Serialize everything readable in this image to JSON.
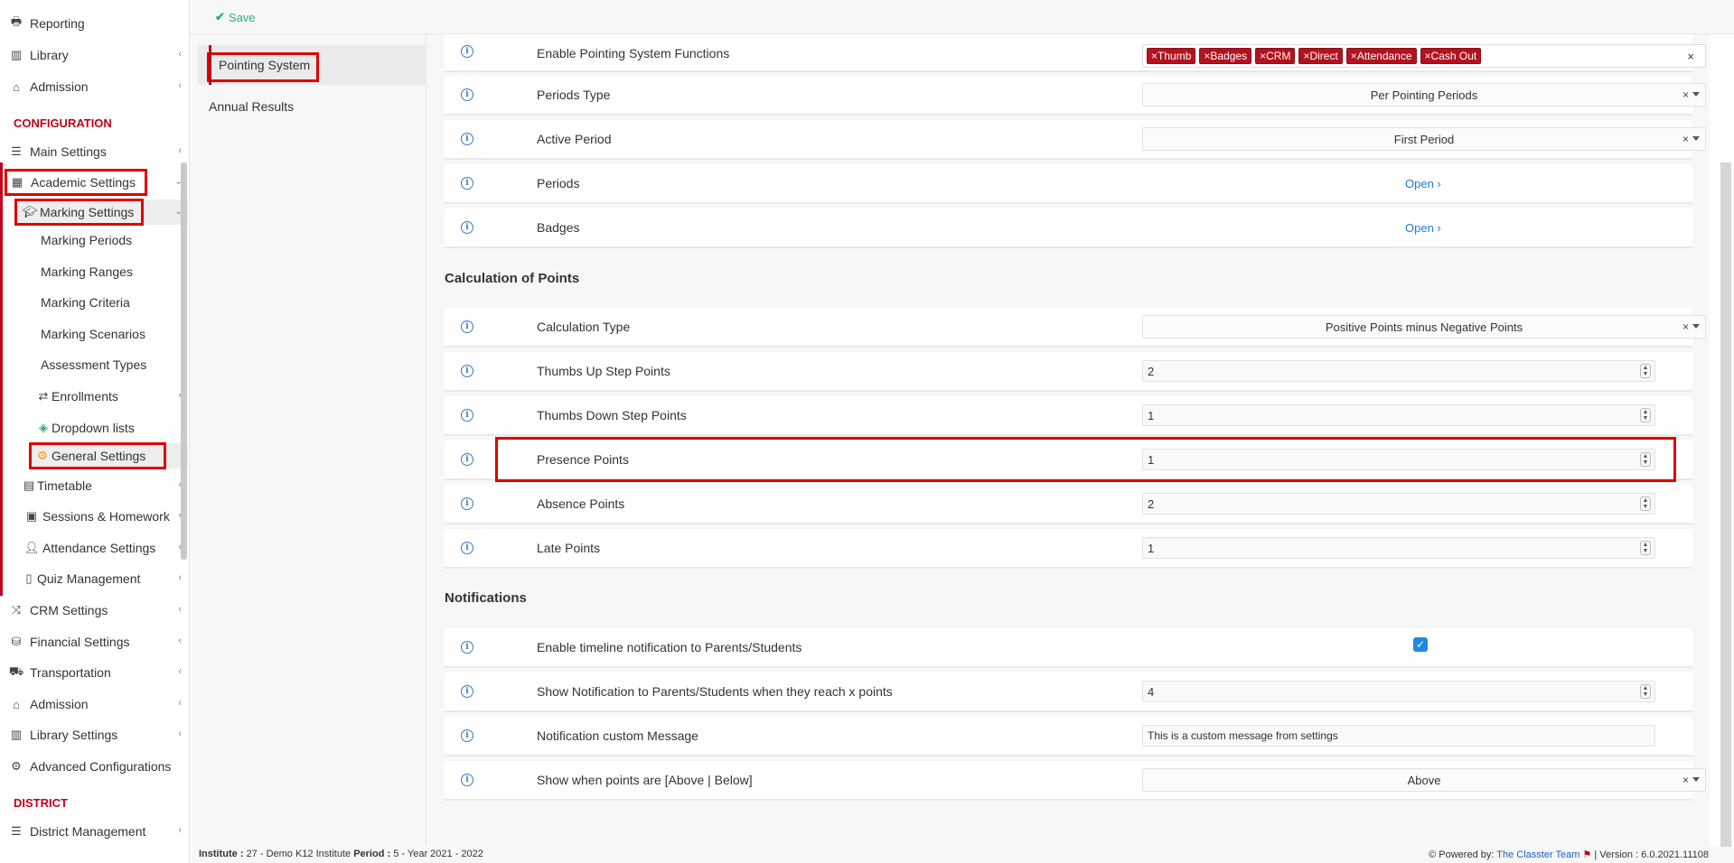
{
  "sidebar": {
    "items_top": [
      {
        "label": "Reporting",
        "icon": "printer-icon"
      },
      {
        "label": "Library",
        "icon": "books-icon"
      },
      {
        "label": "Admission",
        "icon": "institution-icon"
      }
    ],
    "config_header": "CONFIGURATION",
    "config_items": [
      {
        "label": "Main Settings",
        "icon": "sliders-icon"
      },
      {
        "label": "Academic Settings",
        "icon": "classroom-icon"
      },
      {
        "label": "Marking Settings",
        "icon": "graduation-cap-icon"
      },
      {
        "label": "Marking Periods"
      },
      {
        "label": "Marking Ranges"
      },
      {
        "label": "Marking Criteria"
      },
      {
        "label": "Marking Scenarios"
      },
      {
        "label": "Assessment Types"
      },
      {
        "label": "Enrollments",
        "icon": "exchange-icon"
      },
      {
        "label": "Dropdown lists",
        "icon": "layers-icon"
      },
      {
        "label": "General Settings",
        "icon": "gear-icon"
      },
      {
        "label": "Timetable",
        "icon": "calendar-icon"
      },
      {
        "label": "Sessions & Homework",
        "icon": "chalkboard-icon"
      },
      {
        "label": "Attendance Settings",
        "icon": "user-check-icon"
      },
      {
        "label": "Quiz Management",
        "icon": "quiz-icon"
      },
      {
        "label": "CRM Settings",
        "icon": "shuffle-icon"
      },
      {
        "label": "Financial Settings",
        "icon": "coins-icon"
      },
      {
        "label": "Transportation",
        "icon": "bus-icon"
      },
      {
        "label": "Admission",
        "icon": "institution-icon"
      },
      {
        "label": "Library Settings",
        "icon": "books-icon"
      },
      {
        "label": "Advanced Configurations",
        "icon": "cogs-icon"
      }
    ],
    "district_header": "DISTRICT",
    "district_items": [
      {
        "label": "District Management",
        "icon": "list-icon"
      }
    ]
  },
  "toolbar": {
    "save_label": "Save"
  },
  "tabs": [
    {
      "label": "Pointing System"
    },
    {
      "label": "Annual Results"
    }
  ],
  "rows": {
    "enable_functions": {
      "label": "Enable Pointing System Functions",
      "tags": [
        "Thumb",
        "Badges",
        "CRM",
        "Direct",
        "Attendance",
        "Cash Out"
      ]
    },
    "periods_type": {
      "label": "Periods Type",
      "value": "Per Pointing Periods"
    },
    "active_period": {
      "label": "Active Period",
      "value": "First Period"
    },
    "periods": {
      "label": "Periods",
      "link": "Open"
    },
    "badges": {
      "label": "Badges",
      "link": "Open"
    }
  },
  "calc": {
    "title": "Calculation of Points",
    "calculation_type": {
      "label": "Calculation Type",
      "value": "Positive Points minus Negative Points"
    },
    "thumbs_up": {
      "label": "Thumbs Up Step Points",
      "value": "2"
    },
    "thumbs_down": {
      "label": "Thumbs Down Step Points",
      "value": "1"
    },
    "presence": {
      "label": "Presence Points",
      "value": "1"
    },
    "absence": {
      "label": "Absence Points",
      "value": "2"
    },
    "late": {
      "label": "Late Points",
      "value": "1"
    }
  },
  "notifications": {
    "title": "Notifications",
    "timeline": {
      "label": "Enable timeline notification to Parents/Students",
      "checked": true
    },
    "show_when_reach": {
      "label": "Show Notification to Parents/Students when they reach x points",
      "value": "4"
    },
    "custom_message": {
      "label": "Notification custom Message",
      "value": "This is a custom message from settings"
    },
    "above_below": {
      "label": "Show when points are [Above | Below]",
      "value": "Above"
    }
  },
  "footer": {
    "institute_label": "Institute :",
    "institute_value": "27 - Demo K12 Institute",
    "period_label": "Period :",
    "period_value": "5 - Year 2021 - 2022",
    "powered_label": "Powered by:",
    "powered_value": "The Classter Team",
    "version": "| Version : 6.0.2021.11108"
  },
  "colors": {
    "accent": "#c0001a",
    "link": "#1f7bd6",
    "save": "#2fae74",
    "tag": "#b3121f"
  }
}
